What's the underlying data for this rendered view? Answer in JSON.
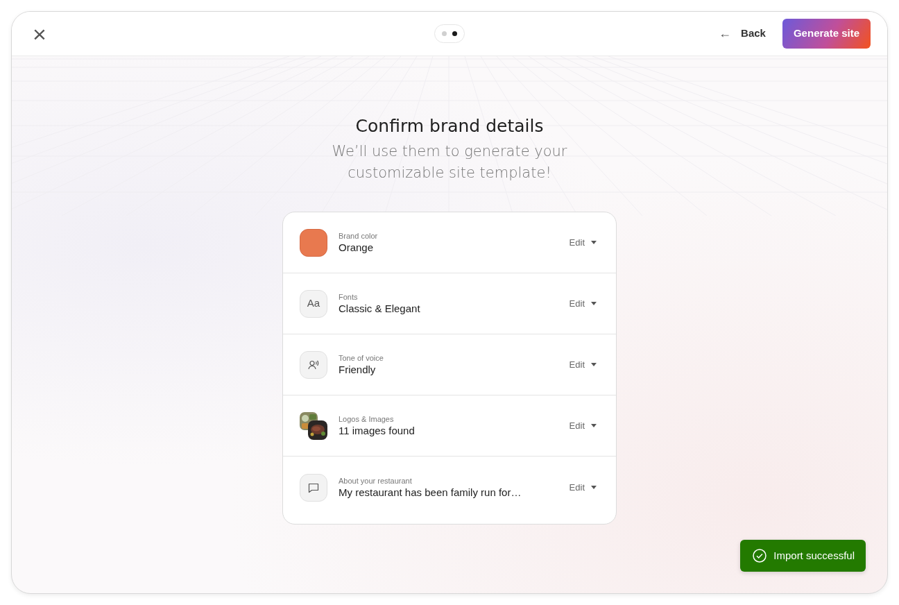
{
  "header": {
    "close": "×",
    "steps": [
      {
        "selected": false
      },
      {
        "selected": true
      }
    ],
    "back": {
      "arrow": "←",
      "label": "Back"
    },
    "primary_button": "Generate site"
  },
  "heading": {
    "title": "Confirm brand details",
    "subtitle": "We’ll use them to generate your customizable site template!"
  },
  "details": [
    {
      "kind": "color",
      "label": "Brand color",
      "value": "Orange",
      "color": "#e8794f",
      "action": "Edit"
    },
    {
      "kind": "fonts",
      "label": "Fonts",
      "value": "Classic & Elegant",
      "glyph": "Aa",
      "action": "Edit"
    },
    {
      "kind": "voice",
      "label": "Tone of voice",
      "value": "Friendly",
      "action": "Edit"
    },
    {
      "kind": "images",
      "label": "Logos & Images",
      "value": "11 images found",
      "action": "Edit"
    },
    {
      "kind": "about",
      "label": "About your restaurant",
      "value": "My restaurant has been family run for…",
      "action": "Edit"
    }
  ],
  "toast": {
    "message": "Import successful"
  }
}
